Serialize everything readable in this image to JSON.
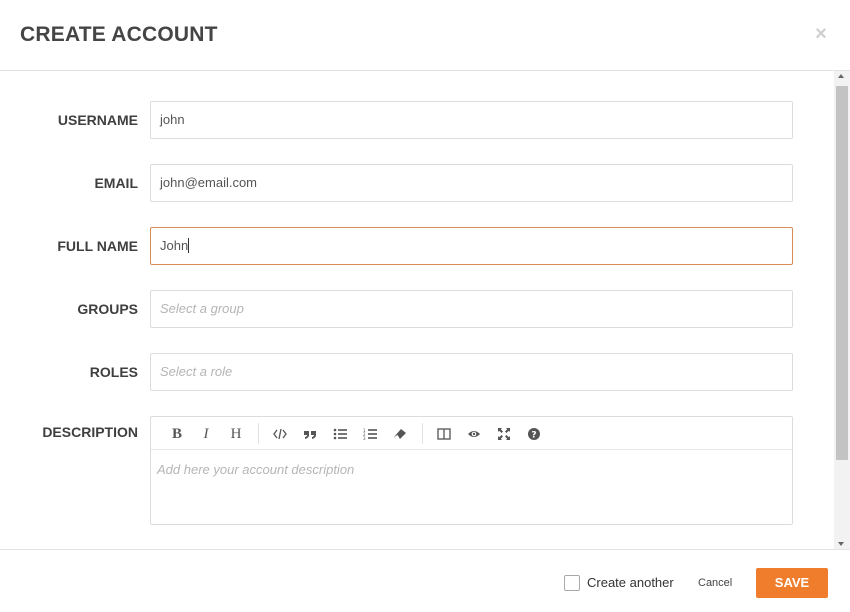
{
  "dialog": {
    "title": "CREATE ACCOUNT",
    "close_icon": "×"
  },
  "form": {
    "username": {
      "label": "USERNAME",
      "value": "john"
    },
    "email": {
      "label": "EMAIL",
      "value": "john@email.com"
    },
    "full_name": {
      "label": "FULL NAME",
      "value": "John"
    },
    "groups": {
      "label": "GROUPS",
      "placeholder": "Select a group"
    },
    "roles": {
      "label": "ROLES",
      "placeholder": "Select a role"
    },
    "description": {
      "label": "DESCRIPTION",
      "placeholder": "Add here your account description",
      "toolbar": {
        "bold": "B",
        "italic": "I",
        "heading": "H",
        "icons": [
          "bold-icon",
          "italic-icon",
          "heading-icon",
          "code-icon",
          "quote-icon",
          "unordered-list-icon",
          "ordered-list-icon",
          "eraser-icon",
          "side-by-side-icon",
          "preview-icon",
          "fullscreen-icon",
          "help-icon"
        ]
      }
    }
  },
  "footer": {
    "create_another_label": "Create another",
    "create_another_checked": false,
    "cancel_label": "Cancel",
    "save_label": "SAVE"
  },
  "colors": {
    "accent": "#ef7d2c",
    "focus_border": "#d98a56"
  }
}
